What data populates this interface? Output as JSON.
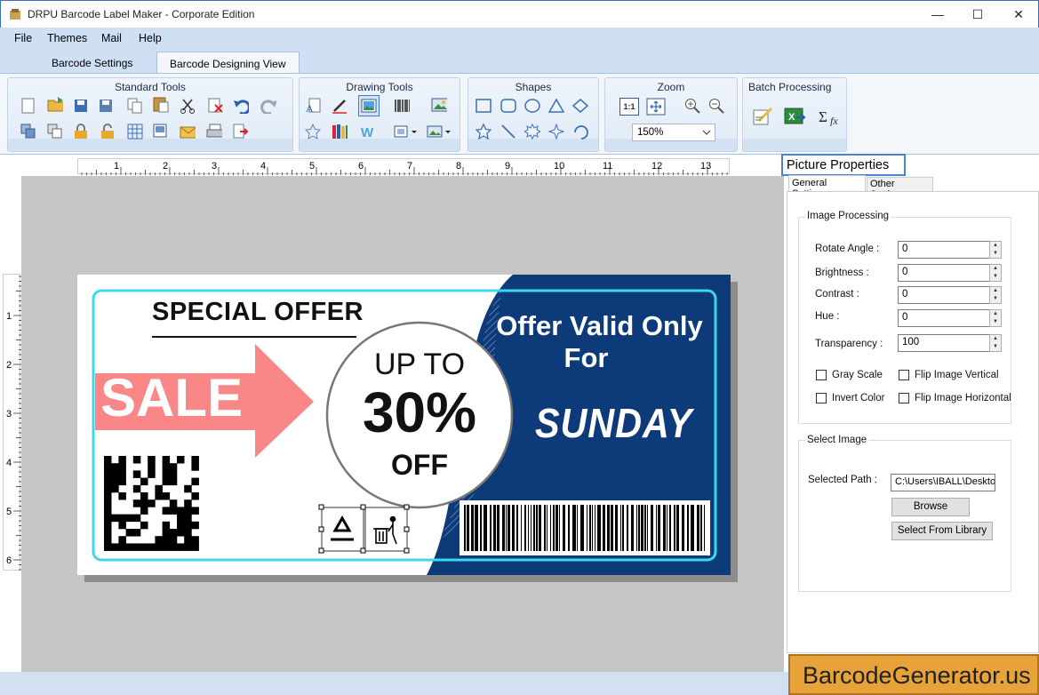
{
  "window": {
    "title": "DRPU Barcode Label Maker - Corporate Edition",
    "minimize": "—",
    "maximize": "☐",
    "close": "✕"
  },
  "menu": {
    "file": "File",
    "themes": "Themes",
    "mail": "Mail",
    "help": "Help"
  },
  "tabs": [
    {
      "label": "Barcode Settings"
    },
    {
      "label": "Barcode Designing View"
    }
  ],
  "ribbon": {
    "standard_tools": "Standard Tools",
    "drawing_tools": "Drawing Tools",
    "shapes": "Shapes",
    "zoom": "Zoom",
    "zoom_value": "150%",
    "zoom_fit": "1:1",
    "batch_processing": "Batch Processing"
  },
  "ruler": {
    "horizontal": [
      "1",
      "2",
      "3",
      "4",
      "5",
      "6",
      "7",
      "8",
      "9",
      "10",
      "11",
      "12",
      "13"
    ],
    "vertical": [
      "1",
      "2",
      "3",
      "4",
      "5",
      "6"
    ]
  },
  "label": {
    "special_offer": "SPECIAL OFFER",
    "sale": "SALE",
    "up_to": "UP TO",
    "percent": "30%",
    "off": "OFF",
    "offer_valid": "Offer Valid Only",
    "for": "For",
    "day": "SUNDAY"
  },
  "panel": {
    "title": "Picture Properties",
    "tab_general": "General Settings",
    "tab_other": "Other Settings",
    "image_processing": "Image Processing",
    "rotate_angle_label": "Rotate Angle :",
    "rotate_angle": "0",
    "brightness_label": "Brightness    :",
    "brightness": "0",
    "contrast_label": "Contrast       :",
    "contrast": "0",
    "hue_label": "Hue              :",
    "hue": "0",
    "transparency_label": "Transparency :",
    "transparency": "100",
    "gray_scale": "Gray Scale",
    "flip_vertical": "Flip Image Vertical",
    "invert_color": "Invert Color",
    "flip_horizontal": "Flip Image Horizontal",
    "select_image": "Select Image",
    "selected_path_label": "Selected Path :",
    "selected_path": "C:\\Users\\IBALL\\Deskto",
    "browse": "Browse",
    "select_library": "Select From Library"
  },
  "brand": "BarcodeGenerator.us"
}
